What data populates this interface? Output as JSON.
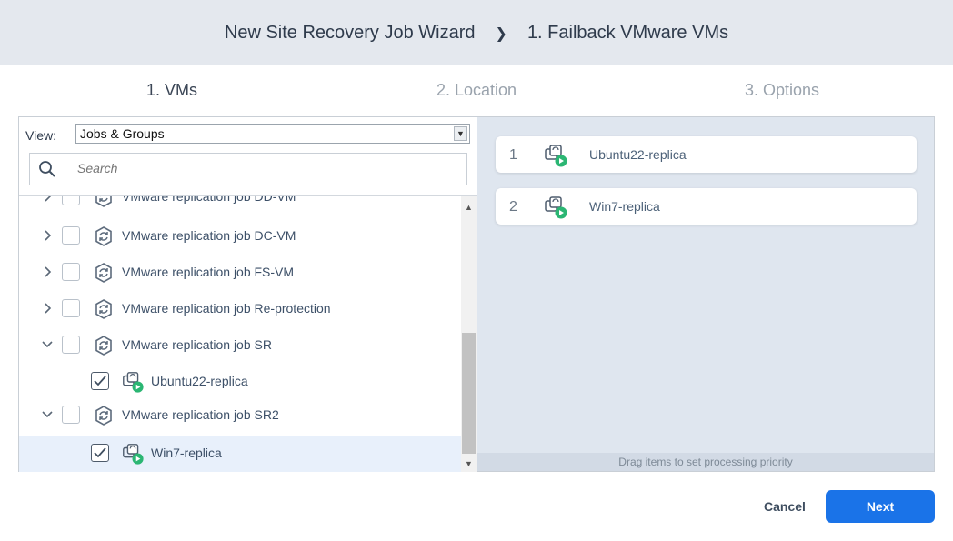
{
  "header": {
    "wizard_title": "New Site Recovery Job Wizard",
    "separator": "❯",
    "step_title": "1. Failback VMware VMs"
  },
  "steps": [
    {
      "label": "1. VMs",
      "active": true
    },
    {
      "label": "2. Location",
      "active": false
    },
    {
      "label": "3. Options",
      "active": false
    }
  ],
  "left_panel": {
    "view_label": "View:",
    "view_value": "Jobs & Groups",
    "search_placeholder": "Search",
    "tree": [
      {
        "label": "VMware replication job DD-VM",
        "type": "job",
        "expanded": false,
        "checked": false
      },
      {
        "label": "VMware replication job DC-VM",
        "type": "job",
        "expanded": false,
        "checked": false
      },
      {
        "label": "VMware replication job FS-VM",
        "type": "job",
        "expanded": false,
        "checked": false
      },
      {
        "label": "VMware replication job Re-protection",
        "type": "job",
        "expanded": false,
        "checked": false
      },
      {
        "label": "VMware replication job SR",
        "type": "job",
        "expanded": true,
        "checked": false
      },
      {
        "label": "Ubuntu22-replica",
        "type": "vm",
        "checked": true
      },
      {
        "label": "VMware replication job SR2",
        "type": "job",
        "expanded": true,
        "checked": false
      },
      {
        "label": "Win7-replica",
        "type": "vm",
        "checked": true,
        "selected": true
      }
    ]
  },
  "right_panel": {
    "items": [
      {
        "num": "1",
        "label": "Ubuntu22-replica"
      },
      {
        "num": "2",
        "label": "Win7-replica"
      }
    ],
    "drag_hint": "Drag items to set processing priority"
  },
  "footer": {
    "cancel_label": "Cancel",
    "next_label": "Next"
  },
  "colors": {
    "accent": "#1a73e8",
    "play_badge": "#2bb673",
    "header_bg": "#e4e8ee",
    "right_panel_bg": "#dfe6ef"
  }
}
